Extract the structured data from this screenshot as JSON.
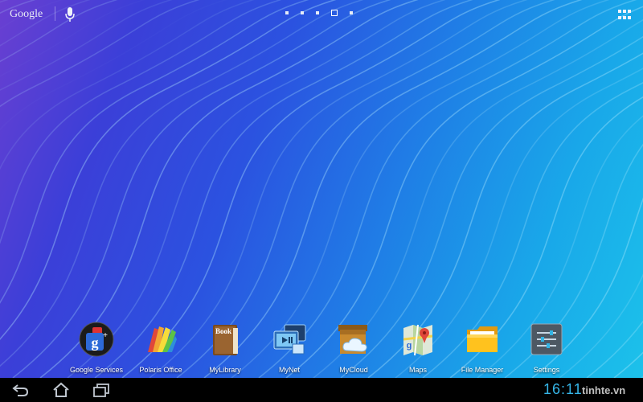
{
  "search": {
    "logo_text": "Google"
  },
  "home": {
    "page_count": 5,
    "current_page": 4,
    "dock_apps": [
      {
        "label": "Google Services",
        "icon": "google-services-icon"
      },
      {
        "label": "Polaris Office",
        "icon": "polaris-office-icon"
      },
      {
        "label": "MyLibrary",
        "icon": "book-icon"
      },
      {
        "label": "MyNet",
        "icon": "mynet-icon"
      },
      {
        "label": "MyCloud",
        "icon": "mycloud-icon"
      },
      {
        "label": "Maps",
        "icon": "maps-icon"
      },
      {
        "label": "File Manager",
        "icon": "folder-icon"
      },
      {
        "label": "Settings",
        "icon": "settings-icon"
      }
    ],
    "mylibrary_icon_text": "Book"
  },
  "navbar": {
    "buttons": [
      "back-icon",
      "home-icon",
      "recent-apps-icon"
    ],
    "clock": "16:11",
    "watermark": "tinhte.vn"
  },
  "colors": {
    "clock": "#36b6e8",
    "wallpaper_left": "#6a3fd1",
    "wallpaper_right": "#1cc3ea"
  }
}
